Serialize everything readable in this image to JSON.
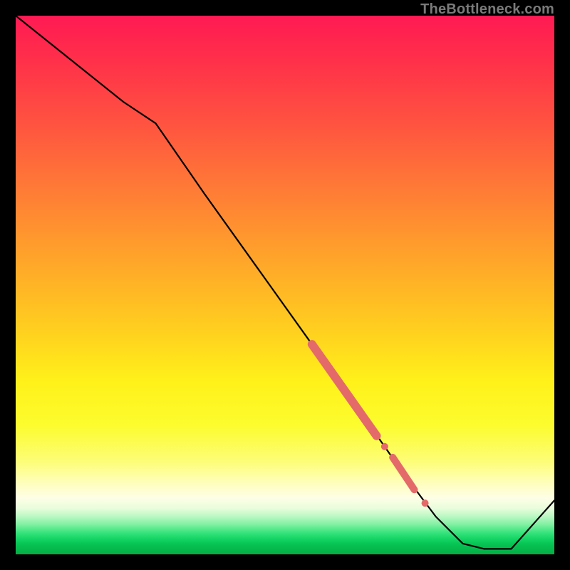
{
  "watermark": "TheBottleneck.com",
  "colors": {
    "line": "#000000",
    "marker": "#e46a6a"
  },
  "chart_data": {
    "type": "line",
    "title": "",
    "xlabel": "",
    "ylabel": "",
    "xlim": [
      0,
      100
    ],
    "ylim": [
      0,
      100
    ],
    "grid": false,
    "legend": false,
    "series": [
      {
        "name": "curve",
        "x": [
          0,
          10,
          20,
          26,
          35,
          45,
          55,
          65,
          72,
          78,
          83,
          87,
          92,
          100
        ],
        "y": [
          100,
          92,
          84,
          80,
          67,
          53,
          39,
          25,
          15,
          7,
          2,
          1,
          1,
          10
        ]
      }
    ],
    "markers": {
      "thick_segment": {
        "x": [
          55,
          67
        ],
        "y": [
          39,
          22
        ]
      },
      "short_segment": {
        "x": [
          70,
          74
        ],
        "y": [
          18,
          12
        ]
      },
      "dots": [
        {
          "x": 68.5,
          "y": 20
        },
        {
          "x": 76,
          "y": 9.5
        }
      ]
    }
  }
}
